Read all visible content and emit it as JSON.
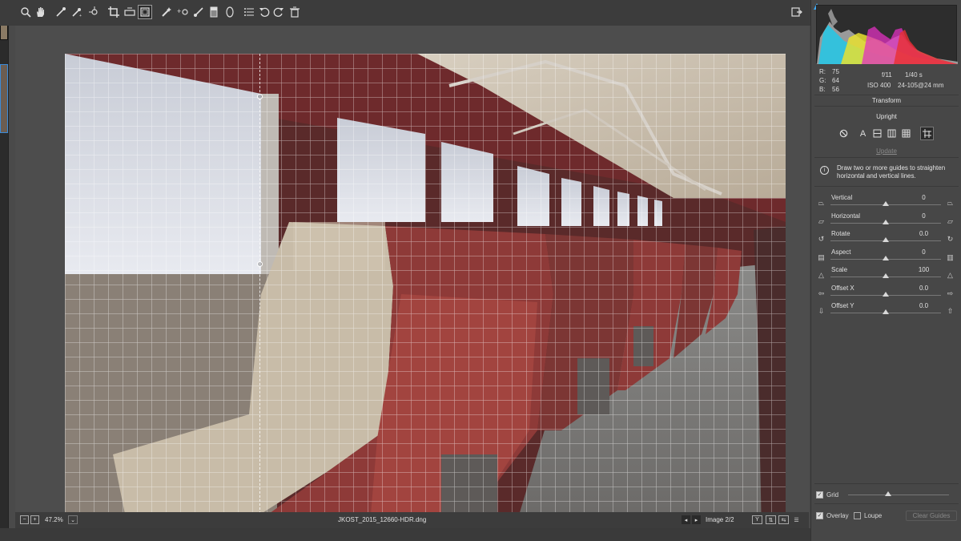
{
  "toolbar": {
    "icons": [
      "zoom-icon",
      "hand-icon",
      "white-balance-icon",
      "color-sampler-icon",
      "targeted-adjustment-icon",
      "crop-icon",
      "straighten-icon",
      "transform-icon",
      "spot-removal-icon",
      "red-eye-icon",
      "adjustment-brush-icon",
      "graduated-filter-icon",
      "radial-filter-icon",
      "preferences-icon",
      "rotate-ccw-icon",
      "rotate-cw-icon",
      "trash-icon"
    ],
    "right_icon": "open-image-icon"
  },
  "image_info": {
    "r_label": "R:",
    "r_value": "75",
    "g_label": "G:",
    "g_value": "64",
    "b_label": "B:",
    "b_value": "56",
    "aperture": "f/11",
    "shutter": "1/40 s",
    "iso": "ISO 400",
    "lens": "24-105@24 mm"
  },
  "transform": {
    "title": "Transform",
    "upright_label": "Upright",
    "upright_auto_letter": "A",
    "update_label": "Update",
    "hint": "Draw two or more guides to straighten horizontal and vertical lines.",
    "sliders": [
      {
        "label": "Vertical",
        "value": "0",
        "position": 0.5
      },
      {
        "label": "Horizontal",
        "value": "0",
        "position": 0.5
      },
      {
        "label": "Rotate",
        "value": "0.0",
        "position": 0.5
      },
      {
        "label": "Aspect",
        "value": "0",
        "position": 0.5
      },
      {
        "label": "Scale",
        "value": "100",
        "position": 0.5
      },
      {
        "label": "Offset X",
        "value": "0.0",
        "position": 0.5
      },
      {
        "label": "Offset Y",
        "value": "0.0",
        "position": 0.5
      }
    ]
  },
  "overlay": {
    "grid_label": "Grid",
    "grid_checked": true,
    "grid_size_position": 0.4,
    "overlay_label": "Overlay",
    "overlay_checked": true,
    "loupe_label": "Loupe",
    "loupe_checked": false,
    "clear_guides_label": "Clear Guides"
  },
  "status": {
    "zoom": "47.2%",
    "filename": "JKOST_2015_12660-HDR.dng",
    "image_counter": "Image 2/2",
    "view_y": "Y"
  }
}
